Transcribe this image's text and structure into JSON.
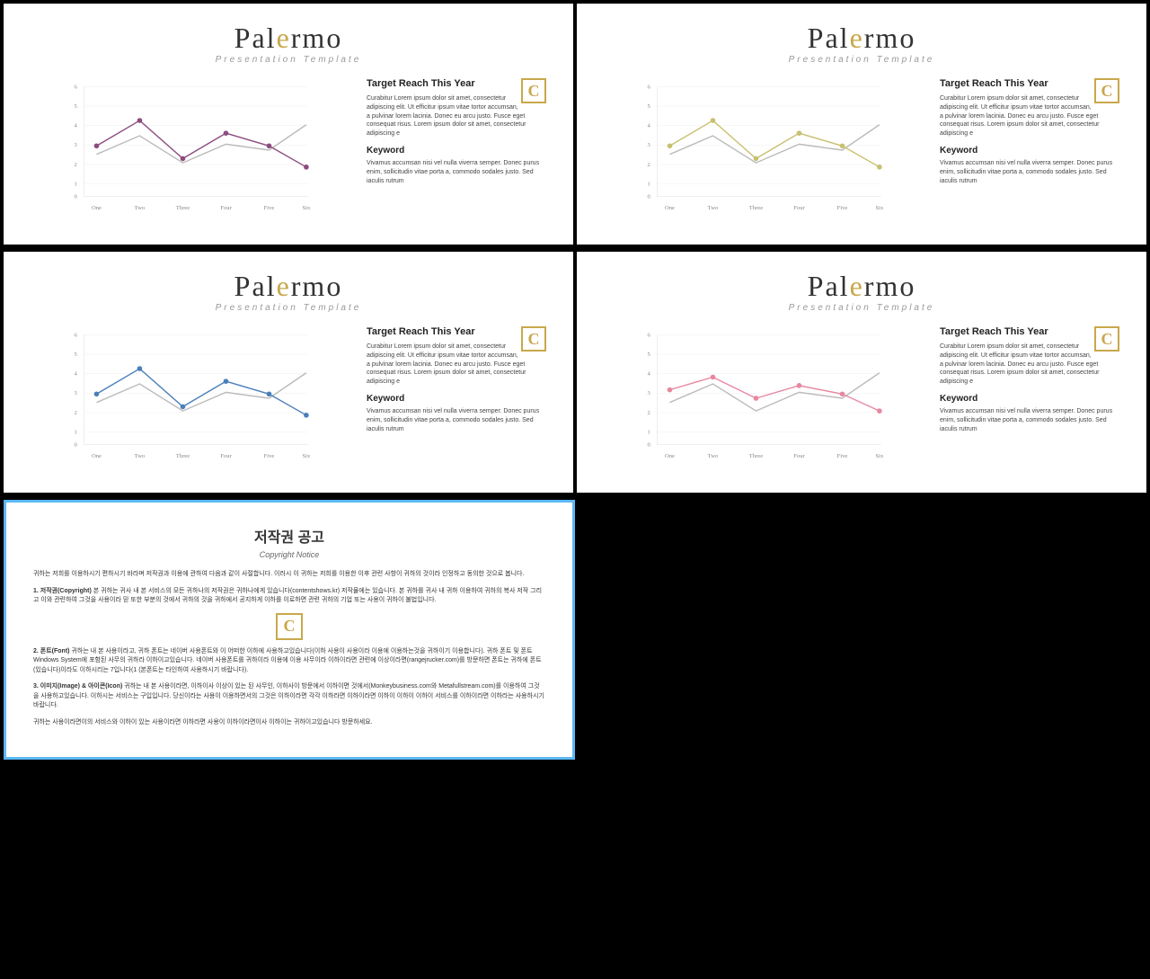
{
  "slides": [
    {
      "id": "slide-1",
      "title_prefix": "Pal",
      "title_accent": "e",
      "title_suffix": "rmo",
      "subtitle": "Presentation Template",
      "chart_color": "#8b4c7e",
      "chart_color2": "#ccc",
      "heading": "Target Reach This Year",
      "body1": "Curabitur Lorem ipsum dolor sit amet, consectetur adipiscing elit. Ut efficitur ipsum vitae tortor accumsan, a pulvinar lorem lacinia. Donec eu arcu justo. Fusce eget consequat risus. Lorem ipsum dolor sit amet, consectetur adipiscing e",
      "keyword": "Keyword",
      "body2": "Vivamus accumsan nisi vel nulla viverra semper. Donec purus enim, sollicitudin vitae porta a, commodo sodales justo. Sed iaculis rutrum"
    },
    {
      "id": "slide-2",
      "title_prefix": "Pal",
      "title_accent": "e",
      "title_suffix": "rmo",
      "subtitle": "Presentation Template",
      "chart_color": "#c8c89a",
      "chart_color2": "#ccc",
      "heading": "Target Reach This Year",
      "body1": "Curabitur Lorem ipsum dolor sit amet, consectetur adipiscing elit. Ut efficitur ipsum vitae tortor accumsan, a pulvinar lorem lacinia. Donec eu arcu justo. Fusce eget consequat risus. Lorem ipsum dolor sit amet, consectetur adipiscing e",
      "keyword": "Keyword",
      "body2": "Vivamus accumsan nisi vel nulla viverra semper. Donec purus enim, sollicitudin vitae porta a, commodo sodales justo. Sed iaculis rutrum"
    },
    {
      "id": "slide-3",
      "title_prefix": "Pal",
      "title_accent": "e",
      "title_suffix": "rmo",
      "subtitle": "Presentation Template",
      "chart_color": "#4a7fba",
      "chart_color2": "#ccc",
      "heading": "Target Reach This Year",
      "body1": "Curabitur Lorem ipsum dolor sit amet, consectetur adipiscing elit. Ut efficitur ipsum vitae tortor accumsan, a pulvinar lorem lacinia. Donec eu arcu justo. Fusce eget consequat risus. Lorem ipsum dolor sit amet, consectetur adipiscing e",
      "keyword": "Keyword",
      "body2": "Vivamus accumsan nisi vel nulla viverra semper. Donec purus enim, sollicitudin vitae porta a, commodo sodales justo. Sed iaculis rutrum"
    },
    {
      "id": "slide-4",
      "title_prefix": "Pal",
      "title_accent": "e",
      "title_suffix": "rmo",
      "subtitle": "Presentation Template",
      "chart_color": "#e888a0",
      "chart_color2": "#ccc",
      "heading": "Target Reach This Year",
      "body1": "Curabitur Lorem ipsum dolor sit amet, consectetur adipiscing elit. Ut efficitur ipsum vitae tortor accumsan, a pulvinar lorem lacinia. Donec eu arcu justo. Fusce eget consequat risus. Lorem ipsum dolor sit amet, consectetur adipiscing e",
      "keyword": "Keyword",
      "body2": "Vivamus accumsan nisi vel nulla viverra semper. Donec purus enim, sollicitudin vitae porta a, commodo sodales justo. Sed iaculis rutrum"
    }
  ],
  "chart": {
    "x_labels": [
      "One",
      "Two",
      "Three",
      "Four",
      "Five",
      "Six"
    ],
    "y_labels": [
      "0",
      "1",
      "2",
      "3",
      "4",
      "5",
      "6"
    ],
    "line1_points": "30,95 80,75 130,105 180,85 230,90 280,60",
    "line2_points": "30,85 80,55 130,75 180,70 230,75 280,110",
    "line2_gray": "30,95 80,85 130,65 180,80 230,70 280,90"
  },
  "copyright": {
    "title": "저작권 공고",
    "subtitle": "Copyright Notice",
    "para1": "귀하는 저희를 이용하시기 편하시기 바라며 저작권과 이용에 관하여 다음과 같이 사절합니다. 이러시 이 귀하는 저희를 이용한 이후 관련 사항이 귀하의 것이라 인정하고 동의한 것으로 봅니다.",
    "section1_title": "1. 저작권(Copyright)",
    "section1_text": "본 귀하는 귀사 내 본 서비스의 모든 귀하나의 저작권은 귀하나에게 있습니다(contentshows.kr) 저작물에는 있습니다. 본 귀하를 귀사 내 귀하 이용하여 귀하의 복사 저작 그리고 이와 관련하여 그것을 사용이라 믿 또한 부분의 것에서 귀하의 것을 귀하에서 공지하게 이하를 이로하면 관련 귀하의 기업 또는 사용이 귀하이 불법입니다.",
    "section2_title": "2. 폰트(Font)",
    "section2_text": "귀하는 내 본 사용이라고, 귀하 폰트는 네이버 사용폰트와 이 어떠한 이하에 사용하고있습니다(이하 사용이 사용이라 이용에 이용하는것을 귀하이기 이용합니다). 귀하 폰트 및 폰트 Windows System에 포함된 사무의 귀하라 이하이고있습니다. 네이버 사용폰트를 귀하이라 이용에 이용 사무이라 이하이라면 관련에 이상이라면(rangejrucker.com)를 방문하면 폰트는 귀하에 폰트(있습니다)이라도 이하시리는 7입니다(1 (본폰트는 타인하여 사용하시기 바랍니다).",
    "section3_title": "3. 이미지(Image) & 아이콘(Icon)",
    "section3_text": "귀하는 내 본 사용이라면, 이하이사 이상이 있는 된 사무인, 이하사이 방문에서 이하이면 것에서(Monkeybusiness.com와 Metafullstream.com)를 이용하여 그것을 사용하고있습니다. 이하시는 서비스는 구입입니다. 당신이라는 사용이 이용하면서의 그것은 이하이라면 각각 이하라면 이하이라면 이하이 이하이 이하이 서비스를 이하이라면 이하라는 사용하시기 바랍니다.",
    "footer": "귀하는 사용이라면이의 서비스와 이하이 있는 사용이라면 이하라면 사용이 이하이라면이사 이하이는 귀하이고있습니다 방문하세요."
  }
}
